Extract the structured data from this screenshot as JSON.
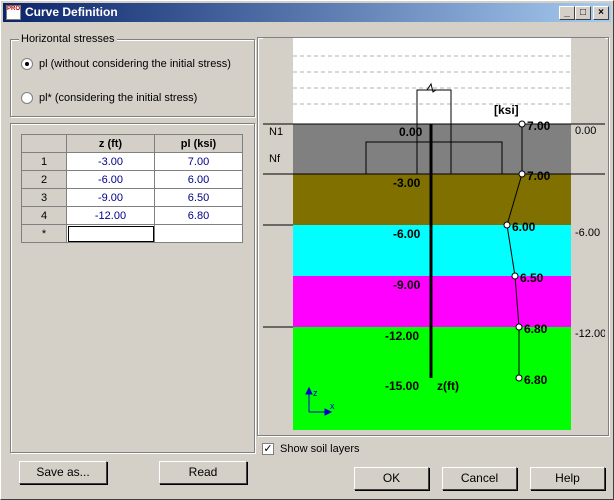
{
  "window": {
    "title": "Curve Definition",
    "icon_text": "PRO"
  },
  "title_buttons": {
    "minimize": "_",
    "maximize": "□",
    "close": "×"
  },
  "horizontal_stresses": {
    "group_title": "Horizontal stresses",
    "options": [
      {
        "label": "pl (without considering the initial stress)",
        "selected": true
      },
      {
        "label": "pl* (considering the initial stress)",
        "selected": false
      }
    ]
  },
  "table": {
    "headers": [
      "z (ft)",
      "pl (ksi)"
    ],
    "rows": [
      {
        "n": "1",
        "z": "-3.00",
        "pl": "7.00"
      },
      {
        "n": "2",
        "z": "-6.00",
        "pl": "6.00"
      },
      {
        "n": "3",
        "z": "-9.00",
        "pl": "6.50"
      },
      {
        "n": "4",
        "z": "-12.00",
        "pl": "6.80"
      }
    ],
    "new_row_marker": "*"
  },
  "buttons": {
    "save_as": "Save as...",
    "read": "Read",
    "ok": "OK",
    "cancel": "Cancel",
    "help": "Help"
  },
  "show_soil_layers": {
    "label": "Show soil layers",
    "checked": true
  },
  "diagram": {
    "unit_label": "[ksi]",
    "axis_label": "z(ft)",
    "level_n1": "N1",
    "level_nf": "Nf",
    "depth_labels": [
      "0.00",
      "-3.00",
      "-6.00",
      "-9.00",
      "-12.00",
      "-15.00"
    ],
    "right_labels": [
      "0.00",
      "-6.00",
      "-12.00"
    ],
    "pl_labels": [
      "7.00",
      "7.00",
      "6.00",
      "6.50",
      "6.80",
      "6.80"
    ],
    "axis_x": "x",
    "axis_z": "z",
    "layer_colors": [
      "#808080",
      "#7f7000",
      "#00ffff",
      "#ff00ff",
      "#00ff00"
    ]
  }
}
